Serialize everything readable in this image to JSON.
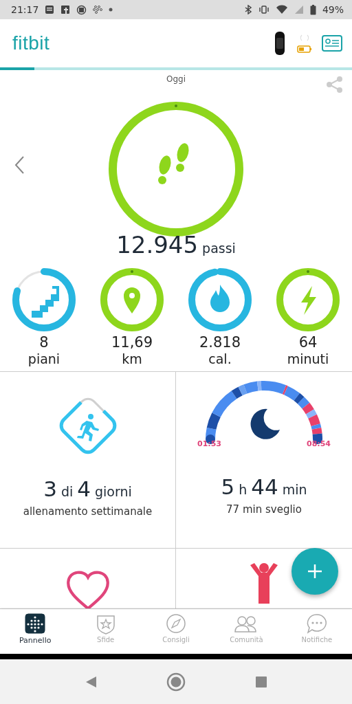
{
  "status_bar": {
    "time": "21:17",
    "battery": "49%"
  },
  "header": {
    "logo": "fitbit"
  },
  "summary": {
    "date": "Oggi",
    "steps": {
      "value": "12.945",
      "unit": "passi",
      "level": 1
    },
    "stats": [
      {
        "kind": "floors",
        "value": "8",
        "label": "piani",
        "level": 0.8,
        "color": "#27b6e0"
      },
      {
        "kind": "distance",
        "value": "11,69",
        "label": "km",
        "level": 1,
        "color": "#8ed61c"
      },
      {
        "kind": "calories",
        "value": "2.818",
        "label": "cal.",
        "level": 0.97,
        "color": "#27b6e0"
      },
      {
        "kind": "active",
        "value": "64",
        "label": "minuti",
        "level": 1,
        "color": "#8ed61c"
      }
    ]
  },
  "tiles": {
    "exercise": {
      "parts": [
        {
          "kind": "number",
          "text": "3"
        },
        {
          "kind": "unit",
          "text": "di"
        },
        {
          "kind": "number",
          "text": "4"
        },
        {
          "kind": "unit",
          "text": "giorni"
        }
      ],
      "caption": "allenamento settimanale"
    },
    "sleep": {
      "start": "01:53",
      "end": "08:54",
      "parts": [
        {
          "kind": "number",
          "text": "5"
        },
        {
          "kind": "unit",
          "text": "h"
        },
        {
          "kind": "number",
          "text": "44"
        },
        {
          "kind": "unit",
          "text": "min"
        }
      ],
      "caption": "77 min sveglio"
    }
  },
  "nav": [
    {
      "kind": "dashboard",
      "label": "Pannello",
      "selected": true
    },
    {
      "kind": "challenges",
      "label": "Sfide",
      "selected": false
    },
    {
      "kind": "guidance",
      "label": "Consigli",
      "selected": false
    },
    {
      "kind": "community",
      "label": "Comunità",
      "selected": false
    },
    {
      "kind": "notifications",
      "label": "Notifiche",
      "selected": false
    }
  ]
}
